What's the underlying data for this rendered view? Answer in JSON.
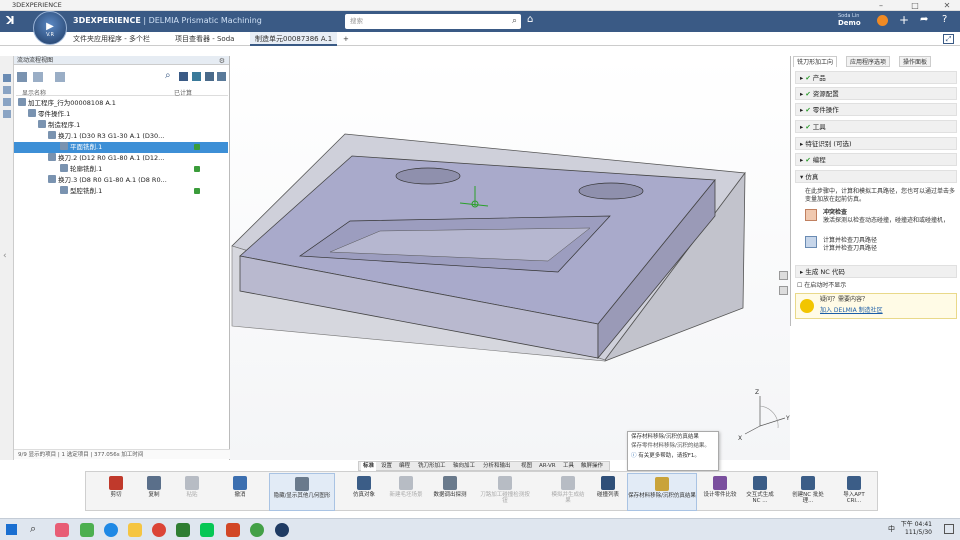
{
  "window": {
    "title": "3DEXPERIENCE"
  },
  "brand": {
    "app_strong": "3DEXPERIENCE",
    "app_name": " | DELMIA",
    "module": " Prismatic Machining",
    "logo_text": "V.R"
  },
  "search": {
    "placeholder": "搜索"
  },
  "user": {
    "name": "Soda Lin",
    "tenant": "Demo"
  },
  "tabs": [
    {
      "label": "文件夹应用程序 - 多个栏"
    },
    {
      "label": "项目查看器 - Soda"
    },
    {
      "label": "制造单元00087386 A.1"
    },
    {
      "label": "+"
    }
  ],
  "tree": {
    "panel_title": "流动流程视图",
    "col_name": "显示名称",
    "col_calc": "已计算",
    "rows": [
      {
        "label": "加工程序_行为00008108 A.1"
      },
      {
        "label": "零件操作.1"
      },
      {
        "label": "制造程序.1"
      },
      {
        "label": "换刀.1 (D30 R3 G1-30 A.1 (D30..."
      },
      {
        "label": "平面铣削.1"
      },
      {
        "label": "换刀.2 (D12 R0 G1-80 A.1 (D12..."
      },
      {
        "label": "轮廓铣削.1"
      },
      {
        "label": "换刀.3 (D8 R0 G1-80 A.1 (D8 R0..."
      },
      {
        "label": "型腔铣削.1"
      }
    ],
    "status": "9/9 显示的项目 | 1 选定项目 | 377.056s 加工时间"
  },
  "right_panel": {
    "tabs": [
      "铣刀形加工向",
      "应用程序选项",
      "操作面板"
    ],
    "steps": [
      {
        "label": "产品"
      },
      {
        "label": "资源配置"
      },
      {
        "label": "零件操作"
      },
      {
        "label": "工具"
      },
      {
        "label": "特征识别 (可选)"
      },
      {
        "label": "编程"
      },
      {
        "label": "仿真"
      }
    ],
    "sim_desc": "在此步骤中，计算和模拟工具路径，您也可以通过单击多变量加放在起前仿真。",
    "sim_item1_title": "冲突检查",
    "sim_item1_desc": "激活探测以检查动态碰撞，碰撞迹和或碰撞机，",
    "sim_item2_title": "计算并检查刀具路径",
    "sim_item2_desc": "计算并检查刀具路径",
    "nc_step": "生成 NC 代码",
    "autohide": "在启动时不显示",
    "help_q": "疑问？需要内容？",
    "help_link": "加入 DELMIA 制造社区"
  },
  "section_tabs": [
    "标准",
    "设置",
    "编程",
    "铣刀形加工",
    "轴向加工",
    "分析和输出",
    "视图",
    "AR-VR",
    "工具",
    "触屏操作"
  ],
  "actions": [
    {
      "label": "剪切",
      "color": "#c0392b"
    },
    {
      "label": "复制",
      "color": "#5a6f8a"
    },
    {
      "label": "粘贴",
      "color": "#b7bcc4"
    },
    {
      "label": "撤消",
      "color": "#3c6fb0"
    },
    {
      "label": "隐藏/显示其他几何图形",
      "color": "#6a7a8c"
    },
    {
      "label": "仿真对象",
      "color": "#3b5d87"
    },
    {
      "label": "新建毛坯场景",
      "color": "#b7bcc4"
    },
    {
      "label": "数据调出探测",
      "color": "#6a7a8c"
    },
    {
      "label": "刀路加工碰撞检测按钮",
      "color": "#b7bcc4"
    },
    {
      "label": "模拟并生成结果",
      "color": "#b7bcc4"
    },
    {
      "label": "碰撞列表",
      "color": "#2f4f78"
    },
    {
      "label": "保存材料移除/沉积仿真结果",
      "color": "#c9a33a"
    },
    {
      "label": "设计零件比较",
      "color": "#7a4f9e"
    },
    {
      "label": "交互式生成 NC ...",
      "color": "#3b5d87"
    },
    {
      "label": "创建NC 批处理...",
      "color": "#3b5d87"
    },
    {
      "label": "导入APT CRI...",
      "color": "#3b5d87"
    }
  ],
  "tooltip": {
    "title": "保存材料移除/沉积仿真结果",
    "desc": "保存零件材料移除/沉积的结果。",
    "more": "有关更多帮助，请按F1。"
  },
  "compass": {
    "x": "X",
    "y": "Y",
    "z": "Z"
  },
  "taskbar": {
    "time": "下午 04:41",
    "date": "111/5/30",
    "lang": "中"
  }
}
